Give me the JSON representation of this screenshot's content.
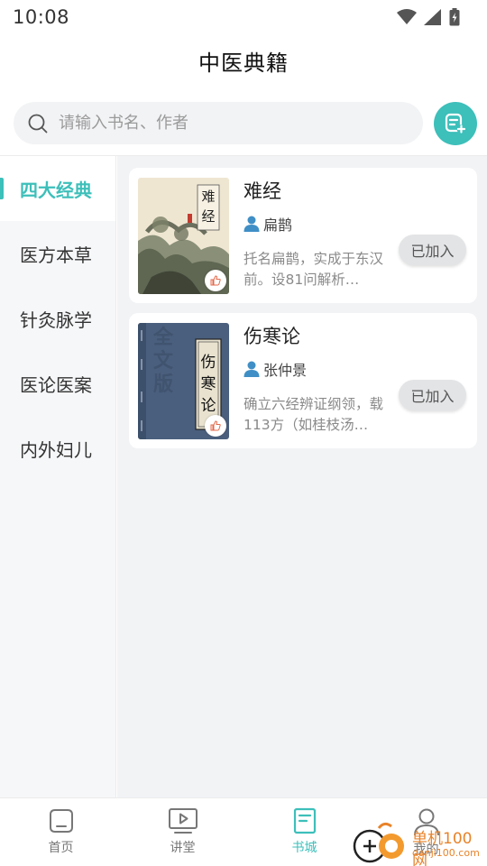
{
  "status_bar": {
    "time": "10:08"
  },
  "header": {
    "title": "中医典籍"
  },
  "search": {
    "placeholder": "请输入书名、作者",
    "value": ""
  },
  "sidebar": {
    "items": [
      {
        "label": "四大经典",
        "active": true
      },
      {
        "label": "医方本草",
        "active": false
      },
      {
        "label": "针灸脉学",
        "active": false
      },
      {
        "label": "医论医案",
        "active": false
      },
      {
        "label": "内外妇儿",
        "active": false
      }
    ]
  },
  "books": [
    {
      "title": "难经",
      "author": "扁鹊",
      "description": "托名扁鹊，实成于东汉前。设81问解析…",
      "action_label": "已加入",
      "cover_text": "难经"
    },
    {
      "title": "伤寒论",
      "author": "张仲景",
      "description": "确立六经辨证纲领，载113方（如桂枝汤…",
      "action_label": "已加入",
      "cover_text": "伤寒论",
      "cover_bg_text": "全文版"
    }
  ],
  "bottom_nav": {
    "items": [
      {
        "label": "首页",
        "icon": "home-icon",
        "active": false
      },
      {
        "label": "讲堂",
        "icon": "video-play-icon",
        "active": false
      },
      {
        "label": "书城",
        "icon": "book-icon",
        "active": true
      },
      {
        "label": "我的",
        "icon": "user-icon",
        "active": false
      }
    ]
  },
  "watermark": {
    "line1": "单机100网",
    "line2": "danji100.com"
  },
  "colors": {
    "accent": "#3dbfba",
    "background": "#f2f3f5",
    "watermark": "#e8832a"
  }
}
